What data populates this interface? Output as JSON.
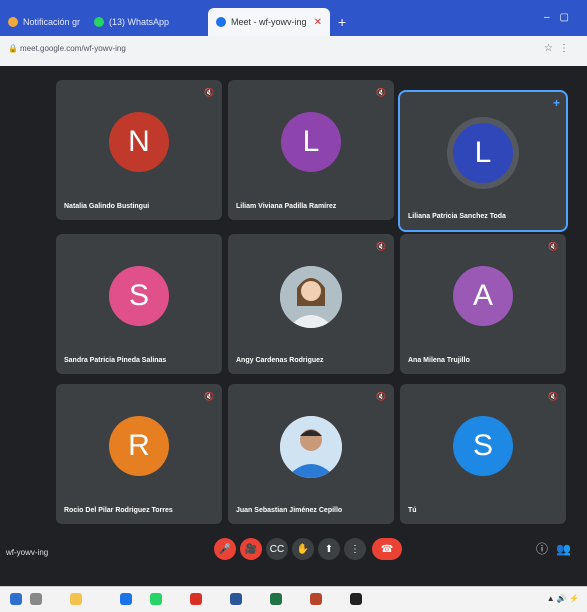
{
  "browser": {
    "tabs": [
      {
        "label": "Notificación grupo - Ledge",
        "color": "#f2a93b"
      },
      {
        "label": "(13) WhatsApp",
        "color": "#25d366"
      },
      {
        "label": "Meet - wf-yowv-ing",
        "color": "#1a73e8"
      }
    ],
    "new_tab": "+",
    "url": "meet.google.com/wf-yowv-ing"
  },
  "participants": [
    {
      "name": "Natalia Galindo Bustingui",
      "initial": "N",
      "color": "#c0392b"
    },
    {
      "name": "Liliam Viviana Padilla Ramírez",
      "initial": "L",
      "color": "#8e44ad"
    },
    {
      "name": "Liliana Patricia Sanchez Toda",
      "initial": "L",
      "color": "#2f47b8",
      "active": true
    },
    {
      "name": "Sandra Patricia Pineda Salinas",
      "initial": "S",
      "color": "#e0518a"
    },
    {
      "name": "Angy Cardenas Rodriguez",
      "initial": "",
      "photo": true
    },
    {
      "name": "Ana Milena Trujillo",
      "initial": "A",
      "color": "#9b59b6"
    },
    {
      "name": "Rocio Del Pilar Rodriguez Torres",
      "initial": "R",
      "color": "#e67e22"
    },
    {
      "name": "Juan Sebastian Jiménez Cepillo",
      "initial": "",
      "photo": true
    },
    {
      "name": "Tú",
      "initial": "S",
      "color": "#1e88e5"
    }
  ],
  "meeting": {
    "code": "wf-yowv-ing"
  },
  "controls": {
    "mic": "🎤",
    "cam": "🎥",
    "captions": "CC",
    "hand": "✋",
    "present": "⬆",
    "more": "⋮",
    "end": "☎"
  },
  "colors": {
    "accent": "#4fa3ff",
    "end_call": "#ea4335"
  }
}
